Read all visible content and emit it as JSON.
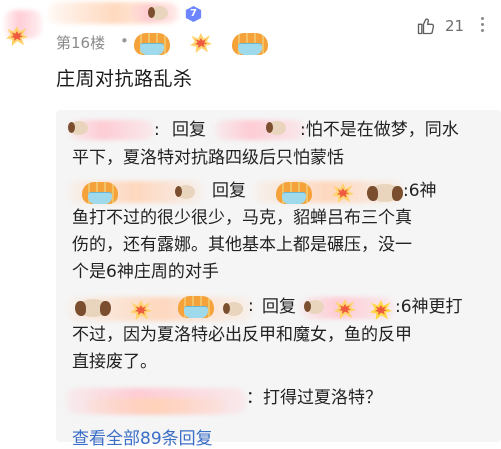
{
  "comment": {
    "level_badge": "7",
    "floor_label": "第16楼",
    "separator": "•",
    "like_count": "21",
    "content": "庄周对抗路乱杀"
  },
  "replies": [
    {
      "action": "回复",
      "lines": [
        ":怕不是在做梦，同水",
        "平下，夏洛特对抗路四级后只怕蒙恬"
      ]
    },
    {
      "action": "回复",
      "lines": [
        ":6神",
        "鱼打不过的很少很少，马克，貂蝉吕布三个真",
        "伤的，还有露娜。其他基本上都是碾压，没一",
        "个是6神庄周的对手"
      ]
    },
    {
      "action": "回复",
      "lines": [
        ":6神更打",
        "不过，因为夏洛特必出反甲和魔女，鱼的反甲",
        "直接废了。"
      ]
    },
    {
      "text": "：打得过夏洛特？"
    }
  ],
  "view_all": "查看全部89条回复",
  "colors": {
    "link": "#3b6ec7",
    "reply_bg": "#f5f5f5",
    "badge": "#6d86ff"
  },
  "icons": [
    "avatar-sticker",
    "thumbs-up-icon",
    "more-icon",
    "level-badge-icon"
  ]
}
